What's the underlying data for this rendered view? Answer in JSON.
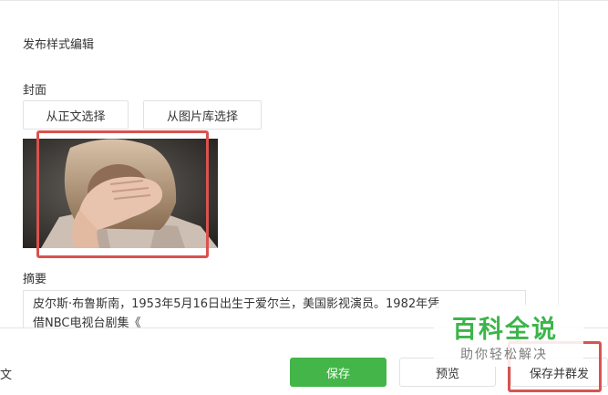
{
  "editor": {
    "section_title": "发布样式编辑",
    "cover_label": "封面",
    "buttons": {
      "from_article": "从正文选择",
      "from_library": "从图片库选择"
    },
    "cover_image": {
      "description_icon": "cover-photo"
    },
    "summary_label": "摘要",
    "summary_text": "皮尔斯·布鲁斯南，1953年5月16日出生于爱尔兰，美国影视演员。1982年凭\n借NBC电视台剧集《"
  },
  "footer": {
    "left_text": "文",
    "save_label": "保存",
    "preview_label": "预览",
    "save_publish_label": "保存并群发"
  },
  "watermark": {
    "title": "百科全说",
    "subtitle": "助你轻松解决"
  },
  "colors": {
    "primary_green": "#44b549",
    "highlight_red": "#d9534f",
    "watermark_green": "#3cb54a"
  }
}
